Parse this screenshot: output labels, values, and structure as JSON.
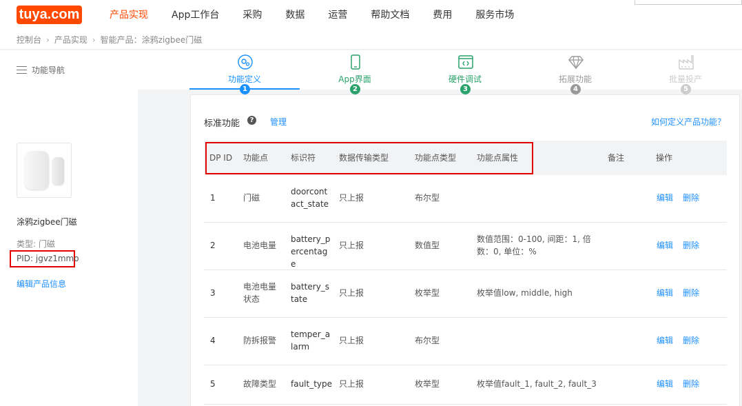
{
  "logo": {
    "text": "tuya.com"
  },
  "nav": {
    "items": [
      {
        "label": "产品实现",
        "active": true
      },
      {
        "label": "App工作台"
      },
      {
        "label": "采购"
      },
      {
        "label": "数据"
      },
      {
        "label": "运营"
      },
      {
        "label": "帮助文档"
      },
      {
        "label": "费用"
      },
      {
        "label": "服务市场"
      }
    ]
  },
  "breadcrumb": [
    "控制台",
    "产品实现",
    "智能产品：涂鸦zigbee门磁"
  ],
  "sidenav": {
    "label": "功能导航"
  },
  "steps": [
    {
      "label": "功能定义",
      "num": "1",
      "color": "#1890ff",
      "icon": "gear-circle-icon"
    },
    {
      "label": "App界面",
      "num": "2",
      "color": "#2aa26b",
      "icon": "phone-icon"
    },
    {
      "label": "硬件调试",
      "num": "3",
      "color": "#2aa26b",
      "icon": "code-window-icon"
    },
    {
      "label": "拓展功能",
      "num": "4",
      "color": "#999999",
      "icon": "diamond-icon"
    },
    {
      "label": "批量投产",
      "num": "5",
      "color": "#cccccc",
      "icon": "factory-icon"
    }
  ],
  "product": {
    "name": "涂鸦zigbee门磁",
    "type": "类型: 门磁",
    "pid": "PID: jgvz1mmo",
    "edit_label": "编辑产品信息"
  },
  "section": {
    "title": "标准功能",
    "help": "?",
    "manage": "管理",
    "how_link": "如何定义产品功能？"
  },
  "table": {
    "headers": {
      "dp": "DP ID",
      "func": "功能点",
      "ident": "标识符",
      "trans": "数据传输类型",
      "ptype": "功能点类型",
      "attr": "功能点属性",
      "note": "备注",
      "op": "操作"
    },
    "rows": [
      {
        "dp": "1",
        "func": "门磁",
        "ident": "doorcontact_state",
        "trans": "只上报",
        "ptype": "布尔型",
        "attr": "",
        "edit": "编辑",
        "del": "删除"
      },
      {
        "dp": "2",
        "func": "电池电量",
        "ident": "battery_percentage",
        "trans": "只上报",
        "ptype": "数值型",
        "attr": "数值范围：0-100, 间距：1, 倍数：0, 单位：%",
        "edit": "编辑",
        "del": "删除"
      },
      {
        "dp": "3",
        "func": "电池电量状态",
        "ident": "battery_state",
        "trans": "只上报",
        "ptype": "枚举型",
        "attr": "枚举值low, middle, high",
        "edit": "编辑",
        "del": "删除"
      },
      {
        "dp": "4",
        "func": "防拆报警",
        "ident": "temper_alarm",
        "trans": "只上报",
        "ptype": "布尔型",
        "attr": "",
        "edit": "编辑",
        "del": "删除"
      },
      {
        "dp": "5",
        "func": "故障类型",
        "ident": "fault_type",
        "trans": "只上报",
        "ptype": "枚举型",
        "attr": "枚举值fault_1, fault_2, fault_3",
        "edit": "编辑",
        "del": "删除"
      }
    ]
  }
}
